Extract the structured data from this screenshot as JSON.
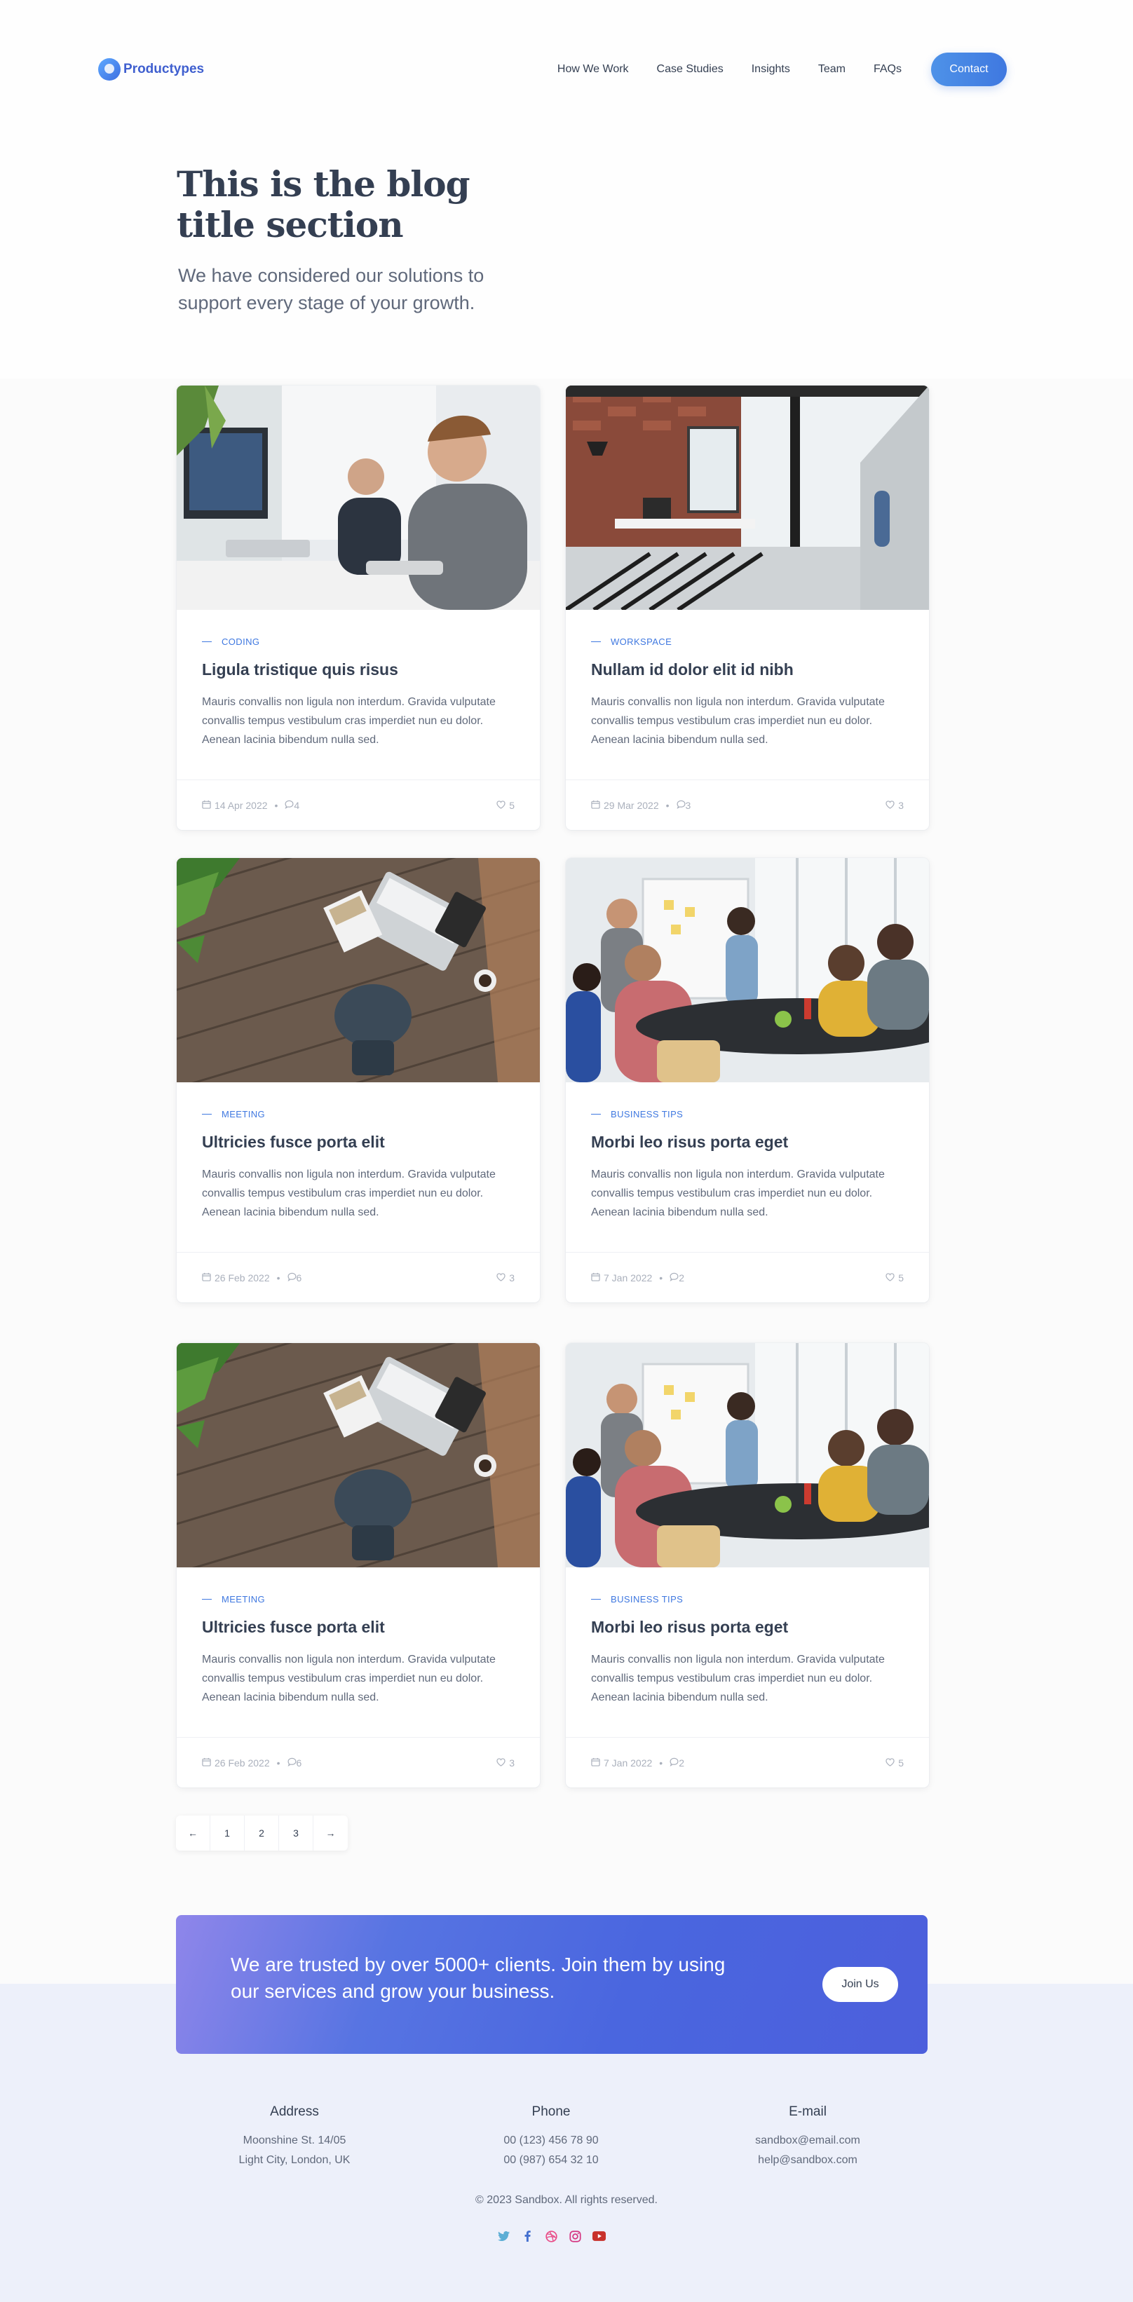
{
  "header": {
    "logo_text": "Productypes",
    "nav": [
      "How We Work",
      "Case Studies",
      "Insights",
      "Team",
      "FAQs"
    ],
    "contact_label": "Contact"
  },
  "hero": {
    "title": "This is the blog title section",
    "subtitle": "We have considered our solutions to support every stage of your growth."
  },
  "posts": [
    {
      "category": "Coding",
      "title": "Ligula tristique quis risus",
      "excerpt": "Mauris convallis non ligula non interdum. Gravida vulputate convallis tempus vestibulum cras imperdiet nun eu dolor. Aenean lacinia bibendum nulla sed.",
      "date": "14 Apr 2022",
      "comments": "4",
      "likes": "5",
      "image": "office-coding-photo"
    },
    {
      "category": "Workspace",
      "title": "Nullam id dolor elit id nibh",
      "excerpt": "Mauris convallis non ligula non interdum. Gravida vulputate convallis tempus vestibulum cras imperdiet nun eu dolor. Aenean lacinia bibendum nulla sed.",
      "date": "29 Mar 2022",
      "comments": "3",
      "likes": "3",
      "image": "loft-workspace-photo"
    },
    {
      "category": "Meeting",
      "title": "Ultricies fusce porta elit",
      "excerpt": "Mauris convallis non ligula non interdum. Gravida vulputate convallis tempus vestibulum cras imperdiet nun eu dolor. Aenean lacinia bibendum nulla sed.",
      "date": "26 Feb 2022",
      "comments": "6",
      "likes": "3",
      "image": "desk-topview-photo"
    },
    {
      "category": "Business Tips",
      "title": "Morbi leo risus porta eget",
      "excerpt": "Mauris convallis non ligula non interdum. Gravida vulputate convallis tempus vestibulum cras imperdiet nun eu dolor. Aenean lacinia bibendum nulla sed.",
      "date": "7 Jan 2022",
      "comments": "2",
      "likes": "5",
      "image": "team-meeting-photo"
    },
    {
      "category": "Meeting",
      "title": "Ultricies fusce porta elit",
      "excerpt": "Mauris convallis non ligula non interdum. Gravida vulputate convallis tempus vestibulum cras imperdiet nun eu dolor. Aenean lacinia bibendum nulla sed.",
      "date": "26 Feb 2022",
      "comments": "6",
      "likes": "3",
      "image": "desk-topview-photo"
    },
    {
      "category": "Business Tips",
      "title": "Morbi leo risus porta eget",
      "excerpt": "Mauris convallis non ligula non interdum. Gravida vulputate convallis tempus vestibulum cras imperdiet nun eu dolor. Aenean lacinia bibendum nulla sed.",
      "date": "7 Jan 2022",
      "comments": "2",
      "likes": "5",
      "image": "team-meeting-photo"
    }
  ],
  "pagination": {
    "prev": "←",
    "pages": [
      "1",
      "2",
      "3"
    ],
    "next": "→"
  },
  "cta": {
    "text": "We are trusted by over 5000+ clients. Join them by using our services and grow your business.",
    "button": "Join Us"
  },
  "footer": {
    "address": {
      "heading": "Address",
      "lines": [
        "Moonshine St. 14/05",
        "Light City, London, UK"
      ]
    },
    "phone": {
      "heading": "Phone",
      "lines": [
        "00 (123) 456 78 90",
        "00 (987) 654 32 10"
      ]
    },
    "email": {
      "heading": "E-mail",
      "lines": [
        "sandbox@email.com",
        "help@sandbox.com"
      ]
    },
    "copyright": "© 2023 Sandbox. All rights reserved.",
    "social": [
      "twitter-icon",
      "facebook-icon",
      "dribbble-icon",
      "instagram-icon",
      "youtube-icon"
    ]
  },
  "colors": {
    "accent": "#3f78e0",
    "heading": "#343f52",
    "body": "#60697b",
    "footer_bg": "#edf0fa"
  }
}
